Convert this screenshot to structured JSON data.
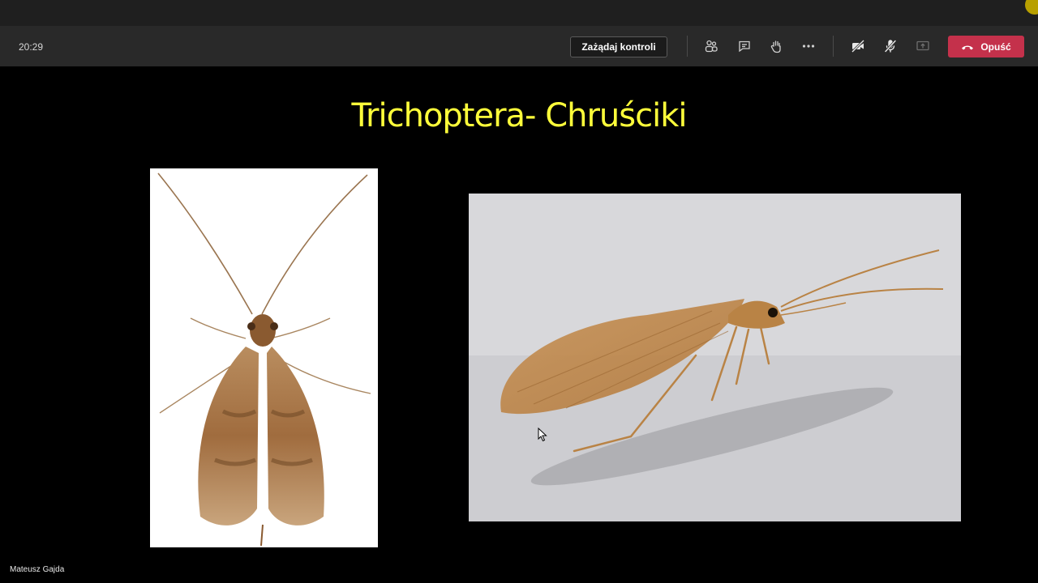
{
  "meeting": {
    "elapsed_time": "20:29",
    "request_control_label": "Zażądaj kontroli",
    "leave_label": "Opuść"
  },
  "toolbar_icons": [
    "participants-icon",
    "chat-icon",
    "raise-hand-icon",
    "more-options-icon",
    "camera-off-icon",
    "mic-off-icon",
    "share-screen-icon",
    "hang-up-icon"
  ],
  "slide": {
    "title": "Trichoptera- Chruściki"
  },
  "presenter": {
    "name": "Mateusz Gajda"
  },
  "colors": {
    "title": "#ffff3a",
    "leave_button": "#c4314b",
    "toolbar": "#292929"
  }
}
